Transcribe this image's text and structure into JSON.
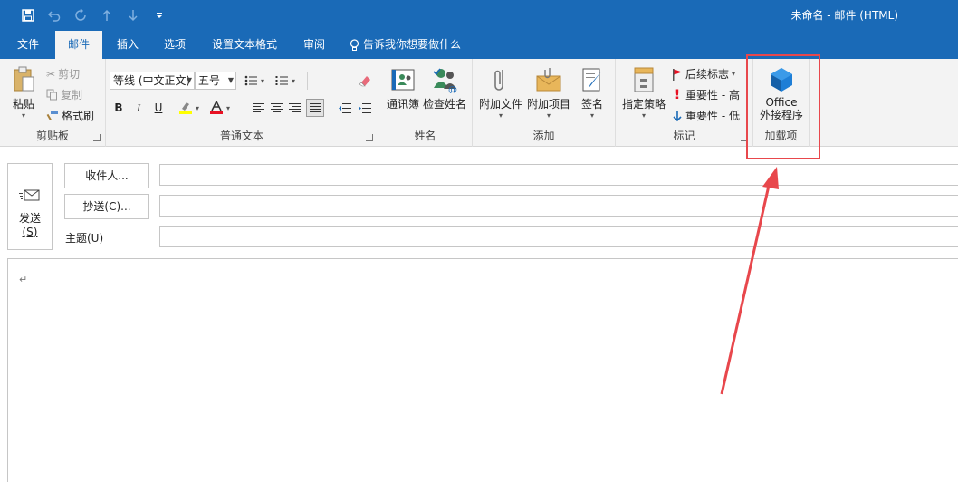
{
  "window": {
    "title": "未命名 - 邮件 (HTML)"
  },
  "qat": {
    "save_icon": "save-icon",
    "undo_icon": "undo-icon",
    "redo_icon": "redo-icon",
    "up_icon": "arrow-up-icon",
    "down_icon": "arrow-down-icon",
    "customize_icon": "customize-qat-icon"
  },
  "tabs": [
    {
      "label": "文件"
    },
    {
      "label": "邮件"
    },
    {
      "label": "插入"
    },
    {
      "label": "选项"
    },
    {
      "label": "设置文本格式"
    },
    {
      "label": "审阅"
    }
  ],
  "tellme": {
    "label": "告诉我你想要做什么"
  },
  "ribbon": {
    "clipboard": {
      "label": "剪贴板",
      "paste": "粘贴",
      "cut": "剪切",
      "copy": "复制",
      "format_painter": "格式刷"
    },
    "basic_text": {
      "label": "普通文本",
      "font": "等线 (中文正文)",
      "size": "五号",
      "bold": "B",
      "italic": "I",
      "underline": "U",
      "highlight_color": "#ffff00",
      "font_color": "#e81123"
    },
    "names": {
      "label": "姓名",
      "address_book": "通讯簿",
      "check_names": "检查姓名"
    },
    "include": {
      "label": "添加",
      "attach_file": "附加文件",
      "attach_item": "附加项目",
      "signature": "签名"
    },
    "tags": {
      "label": "标记",
      "policy": "指定策略",
      "follow_up": "后续标志",
      "high_importance": "重要性 - 高",
      "low_importance": "重要性 - 低"
    },
    "addins": {
      "label": "加载项",
      "office_line1": "Office",
      "office_line2": "外接程序"
    }
  },
  "compose": {
    "send_label": "发送",
    "send_shortcut": "(S)",
    "to_button": "收件人...",
    "cc_button": "抄送(C)...",
    "subject_label": "主题(U)",
    "to_value": "",
    "cc_value": "",
    "subject_value": "",
    "body_mark": "↵"
  },
  "annotation": {
    "color": "#e8474c"
  }
}
